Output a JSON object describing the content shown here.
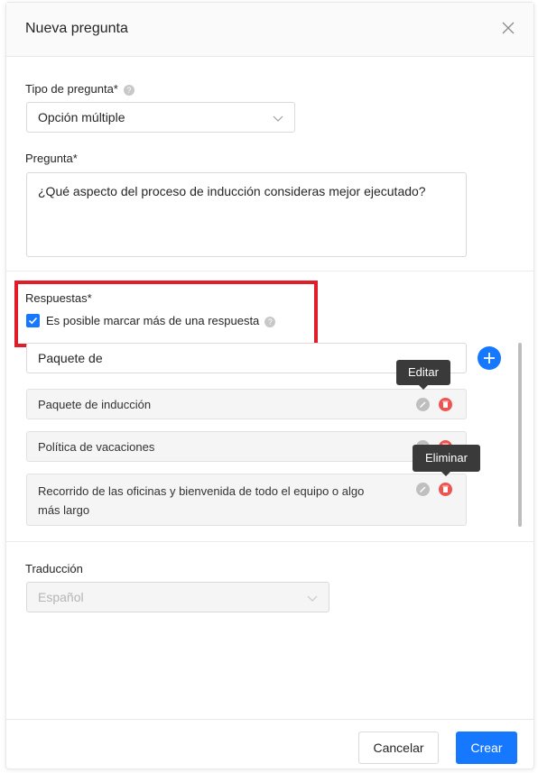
{
  "modal": {
    "title": "Nueva pregunta"
  },
  "question_type": {
    "label": "Tipo de pregunta*",
    "value": "Opción múltiple"
  },
  "question": {
    "label": "Pregunta*",
    "value": "¿Qué aspecto del proceso de inducción consideras mejor ejecutado?"
  },
  "answers": {
    "label": "Respuestas*",
    "multi_checkbox_label": "Es posible marcar más de una respuesta",
    "multi_checked": true,
    "new_answer_value": "Paquete de",
    "items": [
      {
        "text": "Paquete de inducción"
      },
      {
        "text": "Política de vacaciones"
      },
      {
        "text_line1": "Recorrido de las oficinas y bienvenida de todo el equipo o algo",
        "text_line2": "más largo"
      }
    ],
    "tooltips": {
      "edit": "Editar",
      "delete": "Eliminar"
    }
  },
  "translation": {
    "label": "Traducción",
    "value": "Español"
  },
  "footer": {
    "cancel_label": "Cancelar",
    "create_label": "Crear"
  },
  "colors": {
    "primary": "#1677ff",
    "danger": "#ef5350",
    "highlight_box": "#e11d2a"
  },
  "icons": {
    "close": "close-icon",
    "help": "help-icon",
    "chevron": "chevron-down-icon",
    "check": "check-icon",
    "add": "plus-icon",
    "edit": "edit-icon",
    "delete": "trash-icon"
  }
}
